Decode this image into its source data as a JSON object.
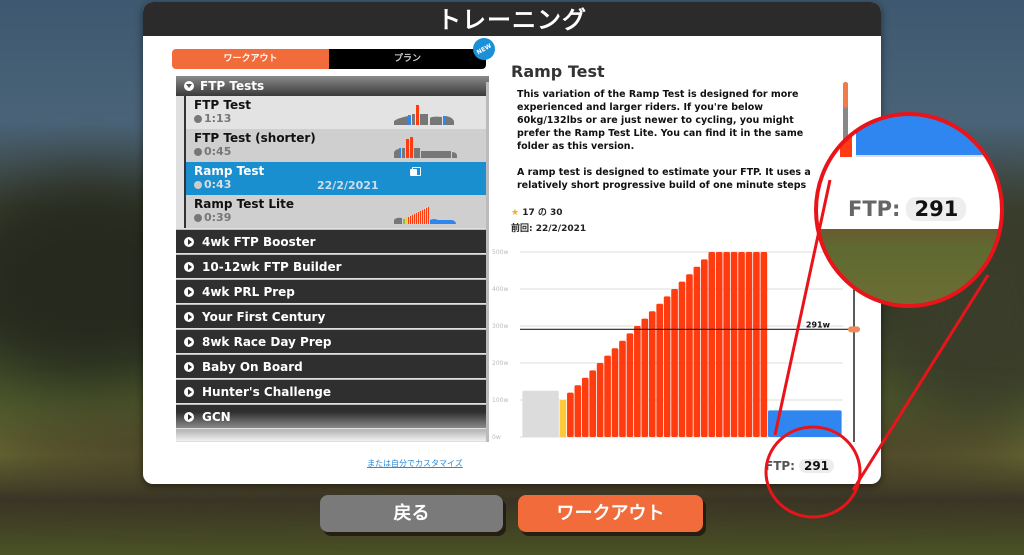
{
  "header": {
    "title": "トレーニング"
  },
  "tabs": [
    {
      "label": "ワークアウト",
      "active": true
    },
    {
      "label": "プラン",
      "active": false
    }
  ],
  "new_badge": "NEW",
  "list": {
    "open_folder": "FTP Tests",
    "workouts": [
      {
        "name": "FTP Test",
        "duration": "1:13",
        "date": "",
        "selected": false
      },
      {
        "name": "FTP Test (shorter)",
        "duration": "0:45",
        "date": "",
        "selected": false
      },
      {
        "name": "Ramp Test",
        "duration": "0:43",
        "date": "22/2/2021",
        "selected": true
      },
      {
        "name": "Ramp Test Lite",
        "duration": "0:39",
        "date": "",
        "selected": false
      }
    ],
    "folders": [
      "4wk FTP Booster",
      "10-12wk FTP Builder",
      "4wk PRL Prep",
      "Your First Century",
      "8wk Race Day Prep",
      "Baby On Board",
      "Hunter's Challenge",
      "GCN"
    ]
  },
  "customize_link": "または自分でカスタマイズ",
  "detail": {
    "title": "Ramp Test",
    "description": "This variation of the Ramp Test is designed for more experienced and larger riders. If you're below 60kg/132lbs or are just newer to cycling, you might prefer the Ramp Test Lite. You can find it in the same folder as this version.\n\n  A ramp test is designed to estimate your FTP. It uses a relatively short progressive build of one minute steps to",
    "rating": "17 の 30",
    "last_done": "前回: 22/2/2021"
  },
  "ftp": {
    "label": "FTP:",
    "value": "291"
  },
  "buttons": {
    "back": "戻る",
    "workout": "ワークアウト"
  },
  "colors": {
    "accent": "#f26b3a",
    "selected": "#1a8fd0",
    "zone_gray": "#dcdcdc",
    "zone_yellow": "#fdc93a",
    "zone_red": "#ff3b10",
    "zone_blue": "#2f86f0",
    "annotation": "#e8141a"
  },
  "chart_data": {
    "type": "bar",
    "title": "",
    "xlabel": "",
    "ylabel": "",
    "ylim": [
      0,
      500
    ],
    "y_ticks": [
      "0w",
      "100w",
      "200w",
      "300w",
      "400w",
      "500w"
    ],
    "ftp_line": {
      "value": 291,
      "label": "291w"
    },
    "segments": [
      {
        "zone": "gray",
        "watts": 125,
        "width": 5
      },
      {
        "zone": "yellow",
        "watts": 100,
        "width": 1
      },
      {
        "zone": "red",
        "watts": 120,
        "width": 1
      },
      {
        "zone": "red",
        "watts": 140,
        "width": 1
      },
      {
        "zone": "red",
        "watts": 160,
        "width": 1
      },
      {
        "zone": "red",
        "watts": 180,
        "width": 1
      },
      {
        "zone": "red",
        "watts": 200,
        "width": 1
      },
      {
        "zone": "red",
        "watts": 220,
        "width": 1
      },
      {
        "zone": "red",
        "watts": 240,
        "width": 1
      },
      {
        "zone": "red",
        "watts": 260,
        "width": 1
      },
      {
        "zone": "red",
        "watts": 280,
        "width": 1
      },
      {
        "zone": "red",
        "watts": 300,
        "width": 1
      },
      {
        "zone": "red",
        "watts": 320,
        "width": 1
      },
      {
        "zone": "red",
        "watts": 340,
        "width": 1
      },
      {
        "zone": "red",
        "watts": 360,
        "width": 1
      },
      {
        "zone": "red",
        "watts": 380,
        "width": 1
      },
      {
        "zone": "red",
        "watts": 400,
        "width": 1
      },
      {
        "zone": "red",
        "watts": 420,
        "width": 1
      },
      {
        "zone": "red",
        "watts": 440,
        "width": 1
      },
      {
        "zone": "red",
        "watts": 460,
        "width": 1
      },
      {
        "zone": "red",
        "watts": 480,
        "width": 1
      },
      {
        "zone": "red",
        "watts": 500,
        "width": 1
      },
      {
        "zone": "red",
        "watts": 500,
        "width": 1
      },
      {
        "zone": "red",
        "watts": 500,
        "width": 1
      },
      {
        "zone": "red",
        "watts": 500,
        "width": 1
      },
      {
        "zone": "red",
        "watts": 500,
        "width": 1
      },
      {
        "zone": "red",
        "watts": 500,
        "width": 1
      },
      {
        "zone": "red",
        "watts": 500,
        "width": 1
      },
      {
        "zone": "red",
        "watts": 500,
        "width": 1
      },
      {
        "zone": "blue",
        "watts": 72,
        "width": 10
      }
    ]
  }
}
